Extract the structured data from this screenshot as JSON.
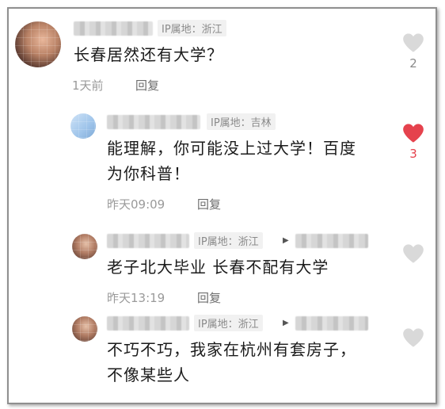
{
  "comments": [
    {
      "ip": "IP属地：浙江",
      "text": "长春居然还有大学？",
      "time": "1天前",
      "reply": "回复",
      "likes": "2",
      "liked": false
    },
    {
      "ip": "IP属地：吉林",
      "text_line1": "能理解，你可能没上过大学！百度",
      "text_line2": "为你科普！",
      "time": "昨天09:09",
      "reply": "回复",
      "likes": "3",
      "liked": true
    },
    {
      "ip": "IP属地：浙江",
      "text": "老子北大毕业 长春不配有大学",
      "time": "昨天13:19",
      "reply": "回复",
      "liked": false
    },
    {
      "ip": "IP属地：浙江",
      "text_line1": "不巧不巧，我家在杭州有套房子，",
      "text_line2": "不像某些人",
      "liked": false
    }
  ],
  "colors": {
    "like_active": "#e5424d",
    "like_inactive": "#d9d9d9"
  },
  "icons": [
    "heart-icon",
    "reply-arrow-icon"
  ]
}
